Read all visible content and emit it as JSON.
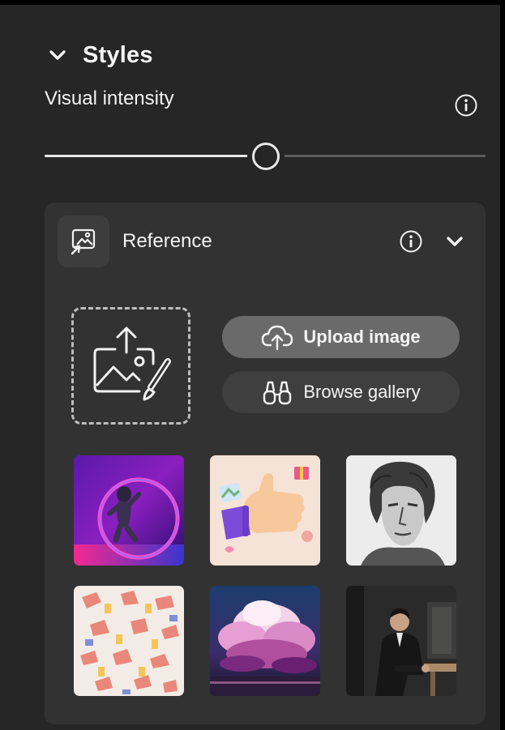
{
  "styles": {
    "title": "Styles"
  },
  "visual_intensity": {
    "label": "Visual intensity",
    "value_fraction": 0.5
  },
  "reference": {
    "title": "Reference",
    "upload_label": "Upload image",
    "browse_label": "Browse gallery",
    "gallery": [
      {
        "name": "neon-astronaut"
      },
      {
        "name": "thumbs-up-3d"
      },
      {
        "name": "engraved-portrait"
      },
      {
        "name": "hands-pattern"
      },
      {
        "name": "pink-clouds"
      },
      {
        "name": "man-in-suit"
      }
    ]
  },
  "colors": {
    "panel_bg": "#262626",
    "card_bg": "#323232",
    "upload_button_bg": "#6a6a6a",
    "browse_button_bg": "#3f3f3f",
    "text": "#f2f2f2"
  },
  "icons": {
    "styles_toggle": "chevron-down-icon",
    "info": "info-icon",
    "reference": "image-reference-icon",
    "reference_toggle": "chevron-down-icon",
    "drop_zone": "image-upload-icon",
    "upload": "cloud-upload-icon",
    "browse": "binoculars-icon"
  }
}
